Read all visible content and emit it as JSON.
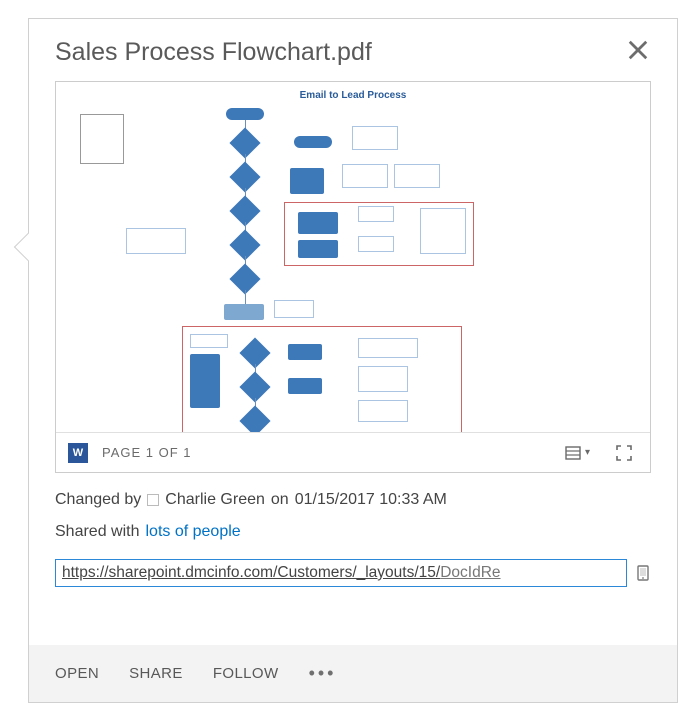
{
  "dialog": {
    "title": "Sales Process Flowchart.pdf"
  },
  "preview": {
    "flow_title": "Email to Lead Process",
    "page_indicator": "PAGE 1 OF 1",
    "word_icon_letter": "W"
  },
  "meta": {
    "changed_by_prefix": "Changed by",
    "user": "Charlie Green",
    "on": "on",
    "datetime": "01/15/2017 10:33 AM",
    "shared_prefix": "Shared with",
    "shared_link": "lots of people"
  },
  "url": {
    "display_prefix": "https://sharepoint.dmcinfo.com/Customers/_layouts/15/",
    "display_trailing": "DocIdRe"
  },
  "actions": {
    "open": "OPEN",
    "share": "SHARE",
    "follow": "FOLLOW"
  }
}
